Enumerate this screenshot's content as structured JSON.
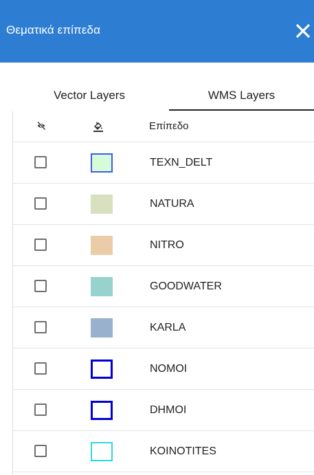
{
  "header": {
    "title": "Θεματικά επίπεδα",
    "background": "#2d7dd2",
    "close_icon": "close-icon"
  },
  "tabs": [
    {
      "label": "Vector Layers",
      "active": false
    },
    {
      "label": "WMS Layers",
      "active": true
    }
  ],
  "table": {
    "headers": {
      "visibility_icon": "eye-slash-icon",
      "style_icon": "paint-bucket-icon",
      "layer_label": "Επίπεδο"
    },
    "rows": [
      {
        "name": "TEXN_DELT",
        "checked": false,
        "fill": "#d7fbd8",
        "border": "#3b5de7"
      },
      {
        "name": "NATURA",
        "checked": false,
        "fill": "#d7e0bf",
        "border": "#d7e0bf"
      },
      {
        "name": "NITRO",
        "checked": false,
        "fill": "#ebcca9",
        "border": "#ebcca9"
      },
      {
        "name": "GOODWATER",
        "checked": false,
        "fill": "#98d2cf",
        "border": "#98d2cf"
      },
      {
        "name": "KARLA",
        "checked": false,
        "fill": "#99b1cf",
        "border": "#99b1cf"
      },
      {
        "name": "NOMOI",
        "checked": false,
        "fill": "#ffffff",
        "border": "#0000d4"
      },
      {
        "name": "DHMOI",
        "checked": false,
        "fill": "#ffffff",
        "border": "#0000d4"
      },
      {
        "name": "KOINOTITES",
        "checked": false,
        "fill": "#ffffff",
        "border": "#2ad8e0"
      }
    ]
  }
}
